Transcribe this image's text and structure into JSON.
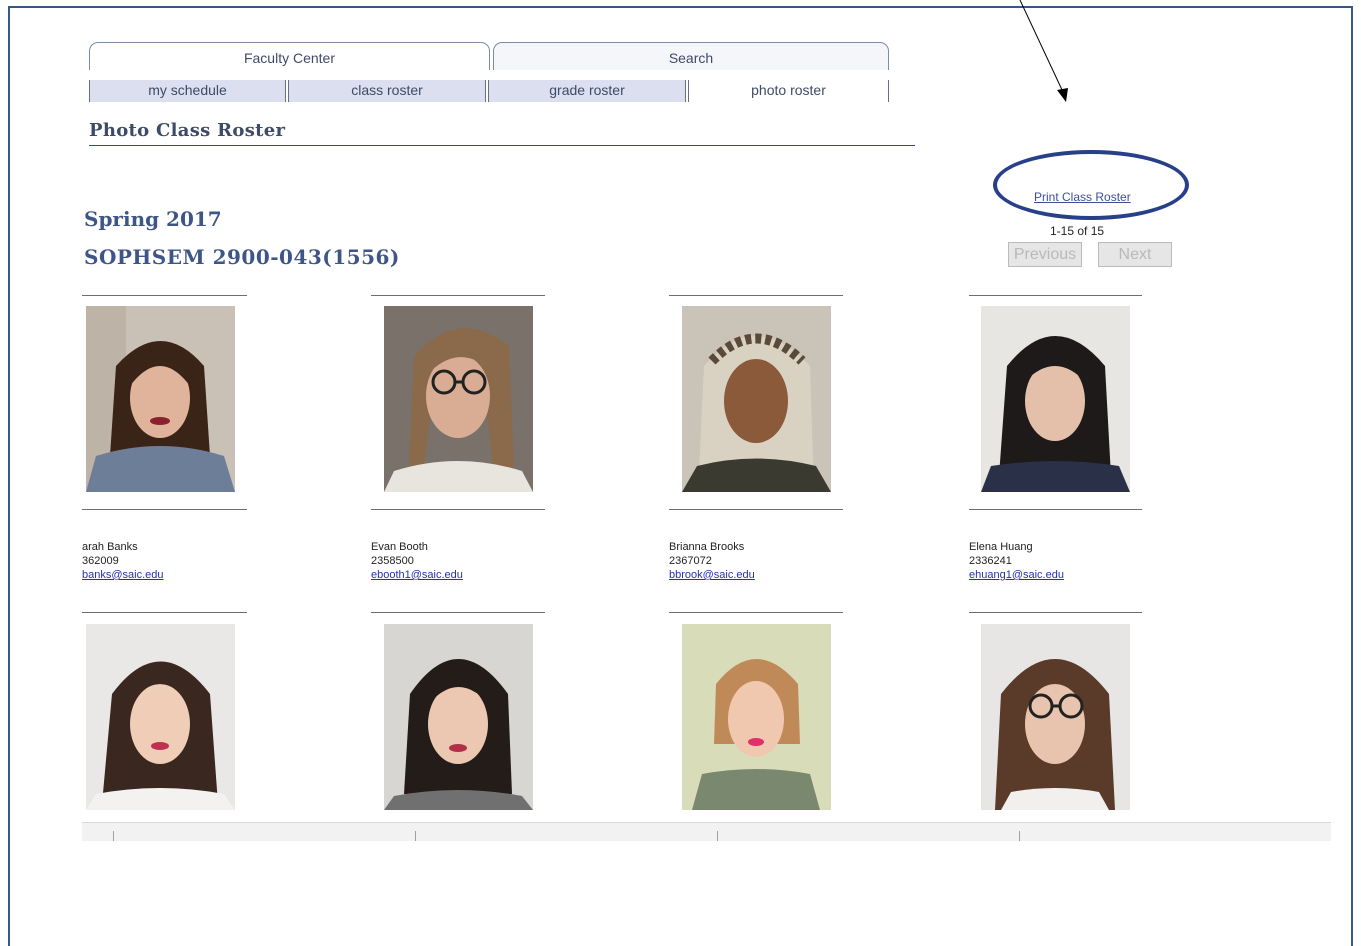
{
  "tabs": [
    {
      "label": "Faculty Center",
      "active": true
    },
    {
      "label": "Search",
      "active": false
    }
  ],
  "subtabs": [
    {
      "label": "my schedule"
    },
    {
      "label": "class roster"
    },
    {
      "label": "grade roster"
    },
    {
      "label": "photo roster",
      "active": true
    }
  ],
  "page_title": "Photo Class Roster",
  "term": "Spring 2017",
  "course": "SOPHSEM 2900-043(1556)",
  "print_link": "Print Class Roster",
  "pagination": {
    "count": "1-15 of 15",
    "previous_label": "Previous",
    "next_label": "Next"
  },
  "students": [
    {
      "name": "arah Banks",
      "id": "362009",
      "email": "banks@saic.edu"
    },
    {
      "name": "Evan Booth",
      "id": "2358500",
      "email": "ebooth1@saic.edu"
    },
    {
      "name": "Brianna Brooks",
      "id": "2367072",
      "email": "bbrook@saic.edu"
    },
    {
      "name": "Elena Huang",
      "id": "2336241",
      "email": "ehuang1@saic.edu"
    }
  ],
  "colors": {
    "accent": "#3d5687",
    "frame": "#37588f",
    "link": "#2233a8",
    "highlight": "#283f8a"
  }
}
